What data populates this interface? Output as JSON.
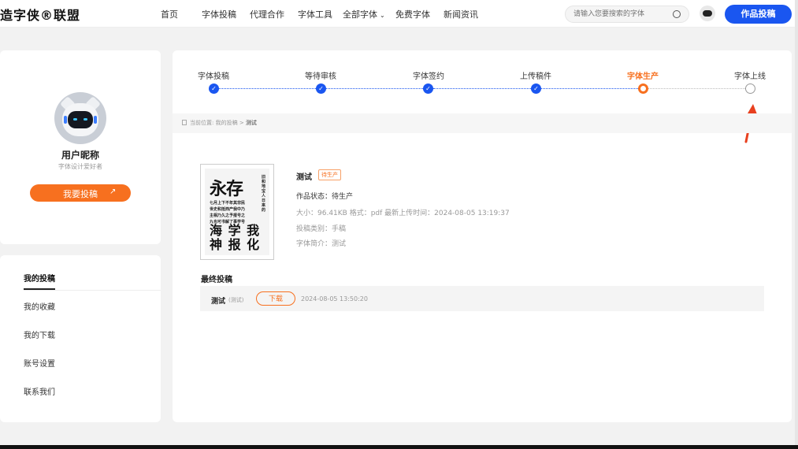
{
  "header": {
    "logo": "造字侠®联盟",
    "nav": [
      {
        "label": "首页"
      },
      {
        "label": "字体投稿"
      },
      {
        "label": "代理合作"
      },
      {
        "label": "字体工具"
      },
      {
        "label": "全部字体",
        "dropdown": true
      },
      {
        "label": "免费字体"
      },
      {
        "label": "新闻资讯"
      }
    ],
    "search_placeholder": "请输入您要搜索的字体",
    "search_icon": "search-icon",
    "submit_button": "作品投稿",
    "accent_color": "#1a56f0"
  },
  "sidebar": {
    "nickname": "用户昵称",
    "subtitle": "字体设计爱好者",
    "submit_button": "我要投稿",
    "submit_icon": "arrow-up-right-icon",
    "menu": [
      {
        "label": "我的投稿",
        "active": true
      },
      {
        "label": "我的收藏"
      },
      {
        "label": "我的下载"
      },
      {
        "label": "账号设置"
      },
      {
        "label": "联系我们"
      }
    ]
  },
  "progress": {
    "steps": [
      {
        "label": "字体投稿",
        "status": "done"
      },
      {
        "label": "等待审核",
        "status": "done"
      },
      {
        "label": "字体签约",
        "status": "done"
      },
      {
        "label": "上传稿件",
        "status": "done"
      },
      {
        "label": "字体生产",
        "status": "current"
      },
      {
        "label": "字体上线",
        "status": "todo"
      }
    ],
    "current_color": "#f7701f",
    "annotation_arrow_color": "#e8401f"
  },
  "breadcrumb": {
    "prefix": "当前位置:",
    "parent": "我的投稿",
    "separator": ">",
    "current": "测试"
  },
  "font": {
    "title": "测试",
    "badge": "待生产",
    "status_line": "作品状态：待生产",
    "meta_line": "大小：96.41KB    格式：pdf    最新上传时间：2024-08-05 13:19:37",
    "category_line": "投稿类别：手稿",
    "intro_line": "字体简介：测试",
    "thumbnail": {
      "big_top": "永存",
      "rows": [
        "七月上下不年其非民",
        "世史和抵西产我中乃",
        "主相乃久之予报号之",
        "九也可书解了事学号"
      ],
      "vertical": "旧和地宝人日来的",
      "big_bottom": [
        "海 学 我",
        "神 报 化"
      ]
    }
  },
  "final": {
    "section_title": "最终投稿",
    "name": "测试",
    "tag": "(测试)",
    "download_button": "下载",
    "time": "2024-08-05 13:50:20"
  }
}
